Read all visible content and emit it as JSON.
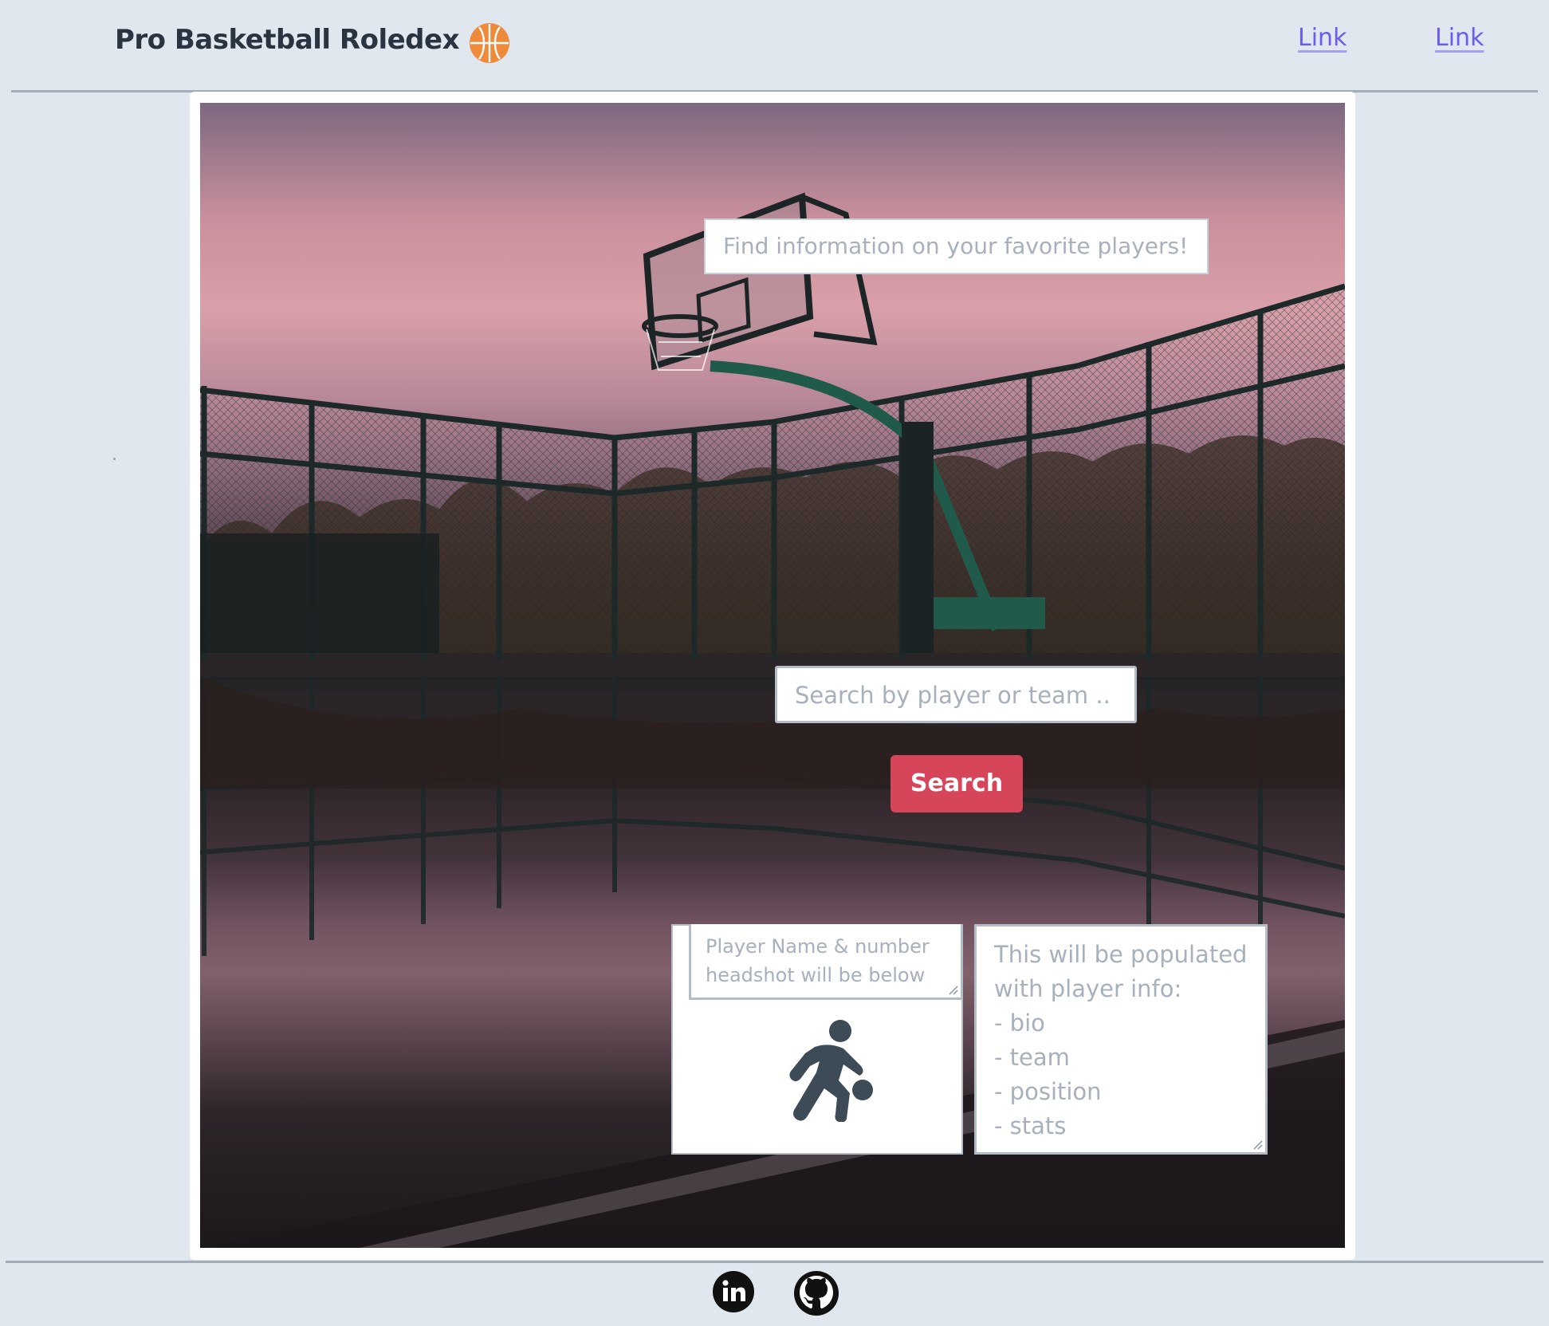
{
  "header": {
    "brand_title": "Pro Basketball Roledex",
    "logo_icon": "basketball-icon",
    "logo_color": "#ef8a3b",
    "links": [
      "Link",
      "Link"
    ],
    "link_color": "#6a5cf0"
  },
  "hero": {
    "banner_text": "Find information on your favorite players!",
    "search_placeholder": "Search by player or team ..",
    "search_button_label": "Search",
    "search_button_color": "#d7455a"
  },
  "player_card": {
    "name_placeholder": "Player Name & number\nheadshot will be below",
    "name_lines": [
      "Player Name & number",
      "headshot will be below"
    ],
    "headshot_icon": "basketball-player-dribbling-icon"
  },
  "info_box": {
    "lines": [
      "This will be populated",
      "with player info:",
      "- bio",
      "- team",
      "- position",
      "- stats"
    ]
  },
  "footer": {
    "social_icons": [
      "linkedin-icon",
      "github-icon"
    ]
  }
}
